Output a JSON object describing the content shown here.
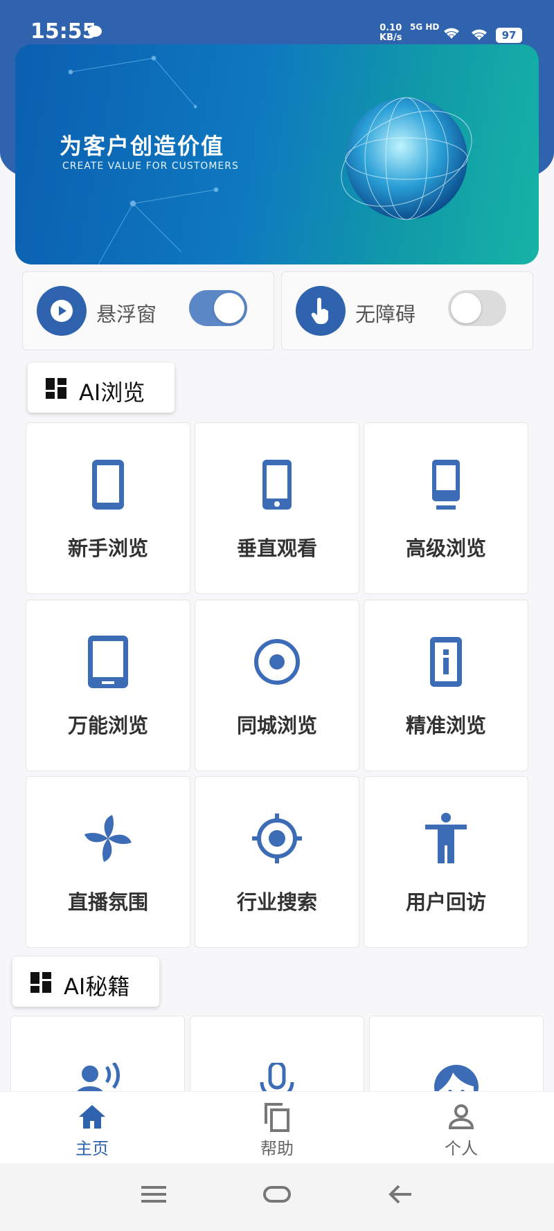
{
  "status": {
    "time": "15:55",
    "speed_value": "0.10",
    "speed_unit": "KB/s",
    "network": "5G HD",
    "battery": "97"
  },
  "banner": {
    "title": "为客户创造价值",
    "subtitle": "CREATE VALUE FOR CUSTOMERS"
  },
  "toggles": [
    {
      "label": "悬浮窗",
      "icon": "play-icon",
      "on": true
    },
    {
      "label": "无障碍",
      "icon": "touch-hand-icon",
      "on": false
    }
  ],
  "section_browse": {
    "title": "AI浏览"
  },
  "browse_items": [
    {
      "label": "新手浏览",
      "icon": "phone-icon"
    },
    {
      "label": "垂直观看",
      "icon": "phone-vertical-icon"
    },
    {
      "label": "高级浏览",
      "icon": "phone-advanced-icon"
    },
    {
      "label": "万能浏览",
      "icon": "tablet-icon"
    },
    {
      "label": "同城浏览",
      "icon": "radio-target-icon"
    },
    {
      "label": "精准浏览",
      "icon": "phone-info-icon"
    },
    {
      "label": "直播氛围",
      "icon": "pinwheel-icon"
    },
    {
      "label": "行业搜索",
      "icon": "crosshair-icon"
    },
    {
      "label": "用户回访",
      "icon": "person-icon"
    }
  ],
  "section_secrets": {
    "title": "AI秘籍"
  },
  "secret_items": [
    {
      "icon": "speaking-person-icon"
    },
    {
      "icon": "microphone-icon"
    },
    {
      "icon": "face-icon"
    }
  ],
  "nav": [
    {
      "label": "主页",
      "icon": "home-icon",
      "active": true
    },
    {
      "label": "帮助",
      "icon": "copy-icon",
      "active": false
    },
    {
      "label": "个人",
      "icon": "user-icon",
      "active": false
    }
  ],
  "colors": {
    "primary": "#2f63ad",
    "icon": "#3b6cb5"
  }
}
